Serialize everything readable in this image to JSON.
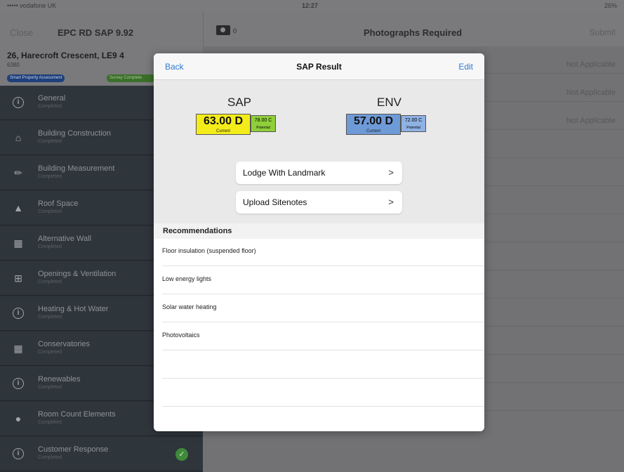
{
  "status": {
    "carrier": "••••• vodafone UK",
    "time": "12:27",
    "battery": "26%"
  },
  "left_header": {
    "close": "Close",
    "title": "EPC RD SAP 9.92"
  },
  "property": {
    "address": "26, Harecroft Crescent, LE9 4",
    "ref": "6380",
    "tag_blue": "Smart Property Assessment",
    "tag_green": "Survey Complete"
  },
  "sidebar": {
    "items": [
      {
        "label": "General",
        "sub": "Completed",
        "icon": "info-icon"
      },
      {
        "label": "Building Construction",
        "sub": "Completed",
        "icon": "house-icon"
      },
      {
        "label": "Building Measurement",
        "sub": "Completed",
        "icon": "pencil-icon"
      },
      {
        "label": "Roof Space",
        "sub": "Completed",
        "icon": "roof-icon"
      },
      {
        "label": "Alternative Wall",
        "sub": "Completed",
        "icon": "wall-icon"
      },
      {
        "label": "Openings & Ventilation",
        "sub": "Completed",
        "icon": "window-icon"
      },
      {
        "label": "Heating & Hot Water",
        "sub": "Completed",
        "icon": "info-icon"
      },
      {
        "label": "Conservatories",
        "sub": "Completed",
        "icon": "grid-icon"
      },
      {
        "label": "Renewables",
        "sub": "Completed",
        "icon": "info-icon"
      },
      {
        "label": "Room Count Elements",
        "sub": "Completed",
        "icon": "bulb-icon"
      },
      {
        "label": "Customer Response",
        "sub": "Completed",
        "icon": "info-icon"
      }
    ]
  },
  "right_header": {
    "photo_count": "0",
    "title": "Photographs Required",
    "submit": "Submit"
  },
  "right_list": {
    "not_applicable": "Not Applicable"
  },
  "modal": {
    "back": "Back",
    "title": "SAP Result",
    "edit": "Edit",
    "sap": {
      "label": "SAP",
      "current": "63.00 D",
      "current_caption": "Current",
      "potential": "78.00 C",
      "potential_caption": "Potential",
      "current_color": "#f4ec1a",
      "potential_color": "#8fcf3a"
    },
    "env": {
      "label": "ENV",
      "current": "57.00 D",
      "current_caption": "Current",
      "potential": "72.00 C",
      "potential_caption": "Potential",
      "current_color": "#6f9ad8",
      "potential_color": "#8fb2e4"
    },
    "buttons": {
      "lodge": "Lodge With Landmark",
      "upload": "Upload Sitenotes"
    },
    "recommendations_title": "Recommendations",
    "recommendations": [
      "Floor insulation (suspended floor)",
      "Low energy lights",
      "Solar water heating",
      "Photovoltaics"
    ]
  }
}
